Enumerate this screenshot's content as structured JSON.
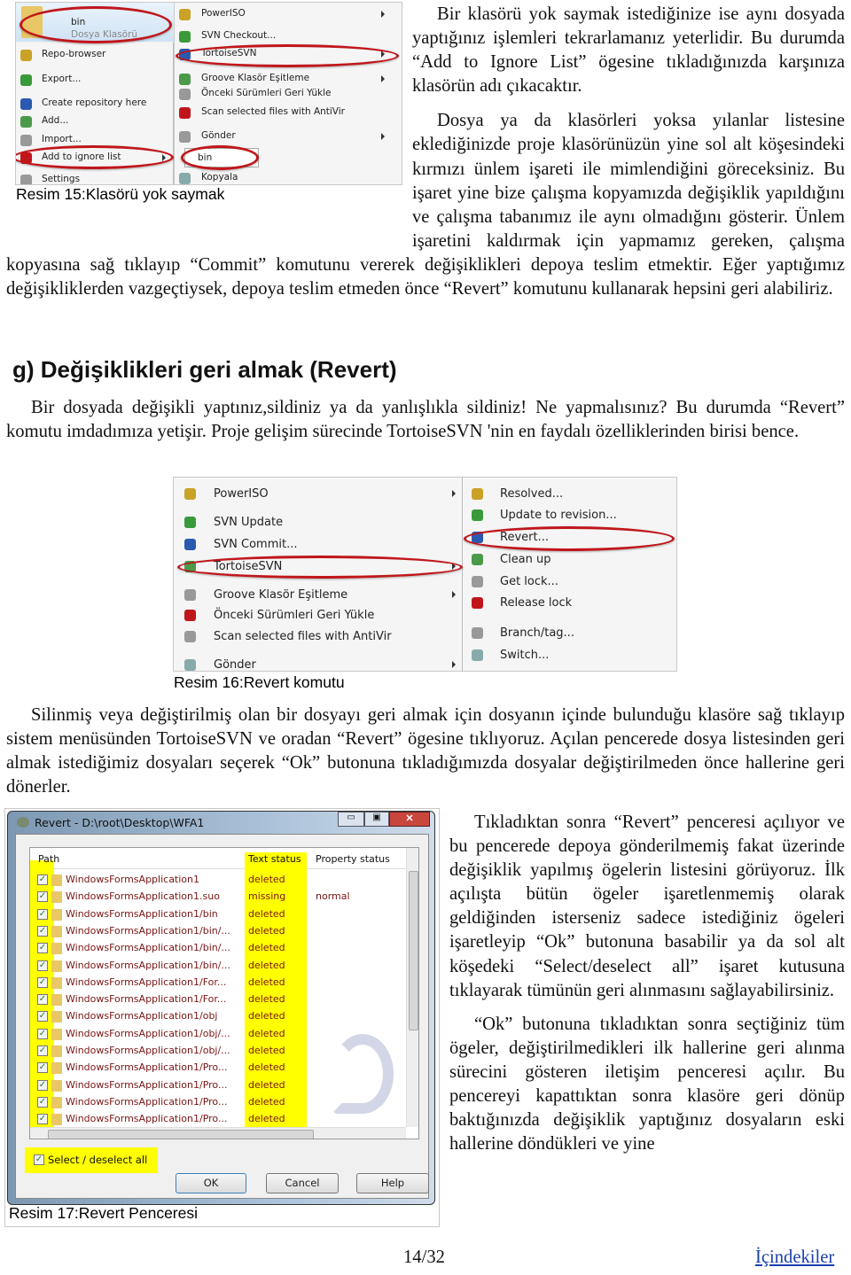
{
  "intro": {
    "p1": "Bir klasörü yok saymak istediğinize ise aynı dosyada yaptığınız işlemleri tekrarlamanız yeterlidir. Bu durumda “Add to Ignore List” ögesine tıkladığınızda karşınıza klasörün adı çıkacaktır.",
    "p2": "Dosya ya da klasörleri yoksa yılanlar listesine eklediğinizde proje klasörünüzün yine sol alt köşesindeki kırmızı ünlem işareti ile mimlendiğini göreceksiniz. Bu işaret yine bize çalışma kopyamızda değişiklik yapıldığını ve çalışma tabanımız ile aynı olmadığını gösterir. Ünlem işaretini kaldırmak için yapmamız gereken, çalışma kopyasına sağ tıklayıp “Commit” komutunu vererek değişiklikleri depoya teslim etmektir. Eğer yaptığımız değişikliklerden vazgeçtiysek, depoya teslim etmeden önce “Revert” komutunu kullanarak hepsini geri alabiliriz."
  },
  "fig15": {
    "caption": "Resim 15:Klasörü yok saymak",
    "folder_name": "bin",
    "folder_type": "Dosya Klasörü",
    "left_menu": [
      "Repo-browser",
      "Export...",
      "Create repository here",
      "Add...",
      "Import...",
      "Add to ignore list",
      "Settings"
    ],
    "right_menu": [
      "PowerISO",
      "SVN Checkout...",
      "TortoiseSVN",
      "Groove Klasör Eşitleme",
      "Önceki Sürümleri Geri Yükle",
      "Scan selected files with AntiVir",
      "Gönder",
      "Kopyala"
    ],
    "submenu_item": "bin",
    "highlight_color": "#c0161b"
  },
  "section_g": {
    "heading": "g) Değişiklikleri geri almak (Revert)",
    "p1": "Bir dosyada değişikli yaptınız,sildiniz ya da yanlışlıkla sildiniz! Ne yapmalısınız? Bu durumda “Revert” komutu imdadımıza yetişir. Proje gelişim sürecinde TortoiseSVN 'nin en faydalı özelliklerinden birisi bence."
  },
  "fig16": {
    "caption": "Resim 16:Revert komutu",
    "left_menu": [
      "PowerISO",
      "SVN Update",
      "SVN Commit...",
      "TortoiseSVN",
      "Groove Klasör Eşitleme",
      "Önceki Sürümleri Geri Yükle",
      "Scan selected files with AntiVir",
      "Gönder"
    ],
    "right_menu": [
      "Resolved...",
      "Update to revision...",
      "Revert...",
      "Clean up",
      "Get lock...",
      "Release lock",
      "Branch/tag...",
      "Switch..."
    ]
  },
  "p_after16": "Silinmiş veya değiştirilmiş olan bir dosyayı geri almak için dosyanın içinde bulunduğu klasöre sağ tıklayıp sistem menüsünden TortoiseSVN ve oradan “Revert” ögesine tıklıyoruz. Açılan pencerede dosya listesinden geri almak istediğimiz dosyaları seçerek “Ok” butonuna tıkladığımızda dosyalar değiştirilmeden önce hallerine geri dönerler.",
  "fig17": {
    "caption": "Resim 17:Revert Penceresi",
    "window_title": "Revert - D:\\root\\Desktop\\WFA1",
    "columns": [
      "Path",
      "Text status",
      "Property status"
    ],
    "rows": [
      {
        "path": "WindowsFormsApplication1",
        "status": "deleted",
        "prop": ""
      },
      {
        "path": "WindowsFormsApplication1.suo",
        "status": "missing",
        "prop": "normal"
      },
      {
        "path": "WindowsFormsApplication1/bin",
        "status": "deleted",
        "prop": ""
      },
      {
        "path": "WindowsFormsApplication1/bin/...",
        "status": "deleted",
        "prop": ""
      },
      {
        "path": "WindowsFormsApplication1/bin/...",
        "status": "deleted",
        "prop": ""
      },
      {
        "path": "WindowsFormsApplication1/bin/...",
        "status": "deleted",
        "prop": ""
      },
      {
        "path": "WindowsFormsApplication1/For...",
        "status": "deleted",
        "prop": ""
      },
      {
        "path": "WindowsFormsApplication1/For...",
        "status": "deleted",
        "prop": ""
      },
      {
        "path": "WindowsFormsApplication1/obj",
        "status": "deleted",
        "prop": ""
      },
      {
        "path": "WindowsFormsApplication1/obj/...",
        "status": "deleted",
        "prop": ""
      },
      {
        "path": "WindowsFormsApplication1/obj/...",
        "status": "deleted",
        "prop": ""
      },
      {
        "path": "WindowsFormsApplication1/Pro...",
        "status": "deleted",
        "prop": ""
      },
      {
        "path": "WindowsFormsApplication1/Pro...",
        "status": "deleted",
        "prop": ""
      },
      {
        "path": "WindowsFormsApplication1/Pro...",
        "status": "deleted",
        "prop": ""
      },
      {
        "path": "WindowsFormsApplication1/Pro...",
        "status": "deleted",
        "prop": ""
      }
    ],
    "select_all": "Select / deselect all",
    "ok": "OK",
    "cancel": "Cancel",
    "help": "Help",
    "highlight_color": "#ffff00"
  },
  "right_text": {
    "p1": "Tıkladıktan sonra “Revert” penceresi açılıyor ve bu pencerede depoya gönderilmemiş fakat üzerinde değişiklik yapılmış ögelerin listesini görüyoruz. İlk açılışta bütün ögeler işaretlenmemiş olarak geldiğinden isterseniz sadece istediğiniz ögeleri işaretleyip “Ok” butonuna basabilir ya da sol alt köşedeki “Select/deselect all” işaret kutusuna tıklayarak tümünün geri alınmasını sağlayabilirsiniz.",
    "p2": "“Ok” butonuna tıkladıktan sonra seçtiğiniz tüm ögeler, değiştirilmedikleri ilk hallerine geri alınma sürecini gösteren iletişim penceresi açılır. Bu pencereyi kapattıktan sonra klasöre geri dönüp baktığınızda değişiklik yaptığınız dosyaların eski hallerine döndükleri ve yine"
  },
  "footer": {
    "page": "14/32",
    "toc_link": "İçindekiler"
  }
}
